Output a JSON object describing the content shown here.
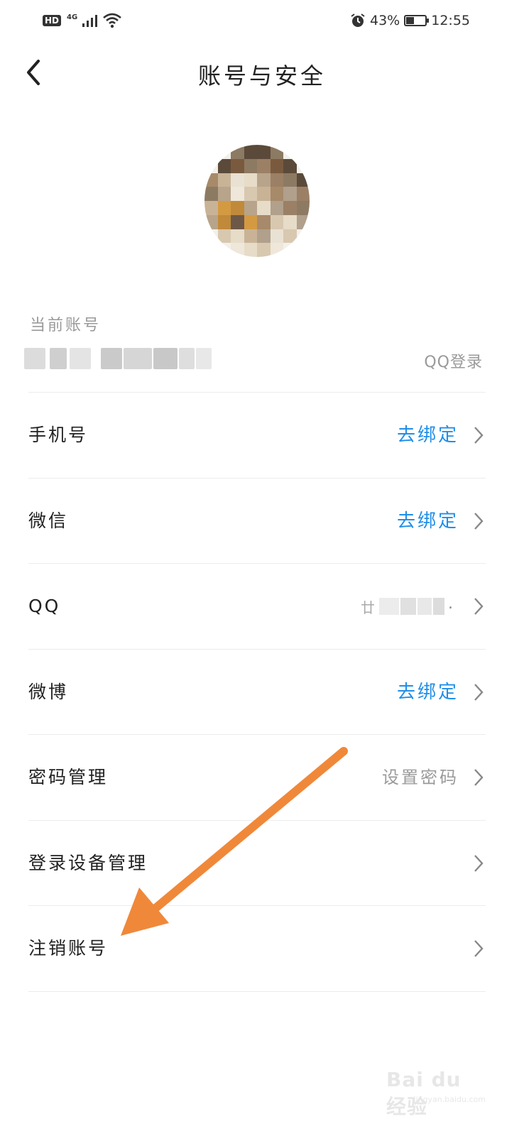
{
  "status_bar": {
    "hd": "HD",
    "network": "4G",
    "battery_percent": "43%",
    "battery_level": 0.43,
    "time": "12:55",
    "icons": [
      "signal-icon",
      "wifi-icon",
      "alarm-icon",
      "battery-icon"
    ]
  },
  "header": {
    "title": "账号与安全",
    "back_icon": "back-arrow-icon"
  },
  "account": {
    "label": "当前账号",
    "login_method": "QQ登录"
  },
  "rows": [
    {
      "label": "手机号",
      "value": "去绑定",
      "value_style": "link"
    },
    {
      "label": "微信",
      "value": "去绑定",
      "value_style": "link"
    },
    {
      "label": "QQ",
      "value": "",
      "value_style": "blurred"
    },
    {
      "label": "微博",
      "value": "去绑定",
      "value_style": "link"
    },
    {
      "label": "密码管理",
      "value": "设置密码",
      "value_style": "muted"
    },
    {
      "label": "登录设备管理",
      "value": "",
      "value_style": "none"
    },
    {
      "label": "注销账号",
      "value": "",
      "value_style": "none"
    }
  ],
  "colors": {
    "link": "#1f8ee8",
    "muted": "#9a9a9a",
    "annotation_arrow": "#f0883a"
  },
  "watermark": {
    "text": "Bai du 经验",
    "sub": "jingyan.baidu.com"
  }
}
